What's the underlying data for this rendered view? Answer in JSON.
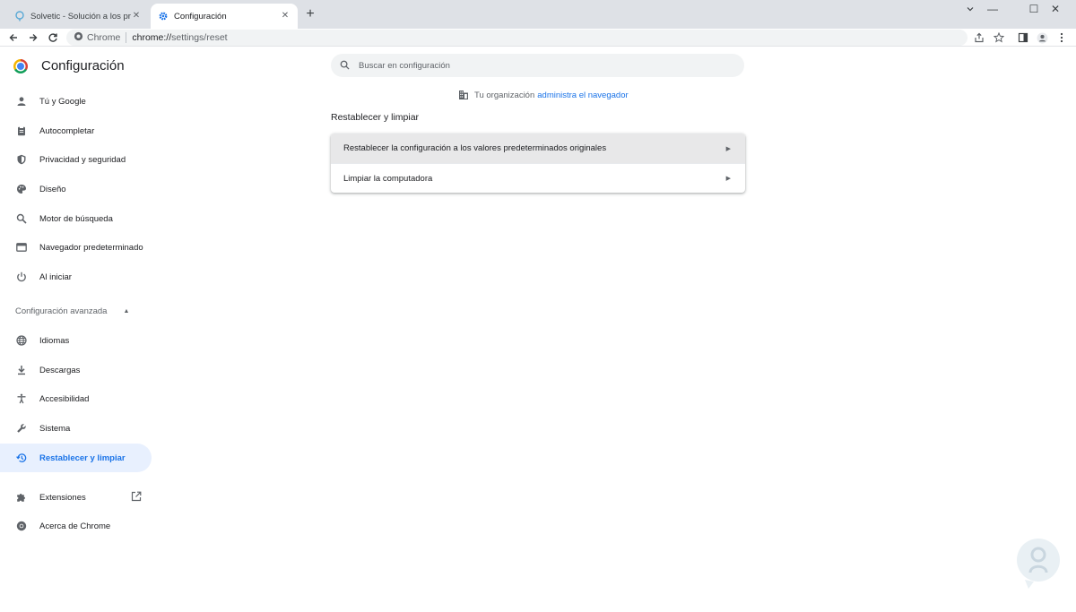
{
  "browser": {
    "tabs": [
      {
        "title": "Solvetic - Solución a los problem",
        "favicon": "solvetic-icon",
        "active": false
      },
      {
        "title": "Configuración",
        "favicon": "gear-icon",
        "active": true
      }
    ],
    "close_glyph": "✕",
    "new_tab_glyph": "+",
    "window_controls": {
      "minimize": "—",
      "maximize": "☐",
      "close": "✕"
    },
    "omnibox": {
      "site_label": "Chrome",
      "url_host": "chrome://",
      "url_path": "settings/reset"
    }
  },
  "settings": {
    "title": "Configuración",
    "search_placeholder": "Buscar en configuración",
    "managed_notice": {
      "text": "Tu organización",
      "link": "administra el navegador"
    },
    "nav": [
      {
        "label": "Tú y Google",
        "icon": "person-icon"
      },
      {
        "label": "Autocompletar",
        "icon": "clipboard-icon"
      },
      {
        "label": "Privacidad y seguridad",
        "icon": "shield-icon"
      },
      {
        "label": "Diseño",
        "icon": "palette-icon"
      },
      {
        "label": "Motor de búsqueda",
        "icon": "search-icon"
      },
      {
        "label": "Navegador predeterminado",
        "icon": "browser-icon"
      },
      {
        "label": "Al iniciar",
        "icon": "power-icon"
      }
    ],
    "advanced_label": "Configuración avanzada",
    "advanced_nav": [
      {
        "label": "Idiomas",
        "icon": "globe-icon"
      },
      {
        "label": "Descargas",
        "icon": "download-icon"
      },
      {
        "label": "Accesibilidad",
        "icon": "accessibility-icon"
      },
      {
        "label": "Sistema",
        "icon": "wrench-icon"
      },
      {
        "label": "Restablecer y limpiar",
        "icon": "restore-icon",
        "selected": true
      }
    ],
    "bottom_nav": [
      {
        "label": "Extensiones",
        "icon": "puzzle-icon"
      },
      {
        "label": "Acerca de Chrome",
        "icon": "chrome-icon"
      }
    ],
    "section_title": "Restablecer y limpiar",
    "rows": [
      {
        "label": "Restablecer la configuración a los valores predeterminados originales"
      },
      {
        "label": "Limpiar la computadora"
      }
    ],
    "row_arrow": "▶",
    "advanced_caret": "▲"
  },
  "colors": {
    "accent": "#1a73e8",
    "selected_bg": "#e8f0fe",
    "tab_strip": "#dee1e6"
  }
}
